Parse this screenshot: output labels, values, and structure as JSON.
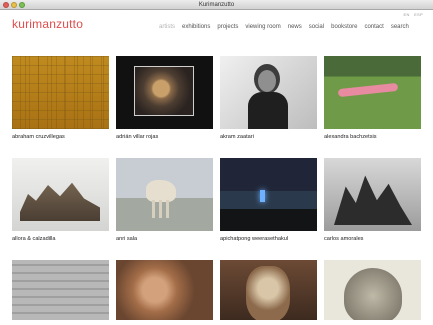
{
  "window": {
    "title": "Kurimanzutto"
  },
  "header": {
    "logo": "kurimanzutto",
    "lang": {
      "en": "EN",
      "es": "ESP"
    }
  },
  "nav": [
    {
      "label": "artists",
      "active": true
    },
    {
      "label": "exhibitions",
      "active": false
    },
    {
      "label": "projects",
      "active": false
    },
    {
      "label": "viewing room",
      "active": false
    },
    {
      "label": "news",
      "active": false
    },
    {
      "label": "social",
      "active": false
    },
    {
      "label": "bookstore",
      "active": false
    },
    {
      "label": "contact",
      "active": false
    },
    {
      "label": "search",
      "active": false
    }
  ],
  "artists": [
    {
      "name": "abraham cruzvillegas"
    },
    {
      "name": "adrián villar rojas"
    },
    {
      "name": "akram zaatari"
    },
    {
      "name": "alexandra bachzetsis"
    },
    {
      "name": "allora & calzadilla"
    },
    {
      "name": "anri sala"
    },
    {
      "name": "apichatpong weerasethakul"
    },
    {
      "name": "carlos amorales"
    },
    {
      "name": ""
    },
    {
      "name": ""
    },
    {
      "name": ""
    },
    {
      "name": ""
    }
  ],
  "colors": {
    "logo": "#e04c4c",
    "nav_active": "#b4b4b4",
    "nav": "#555555"
  }
}
